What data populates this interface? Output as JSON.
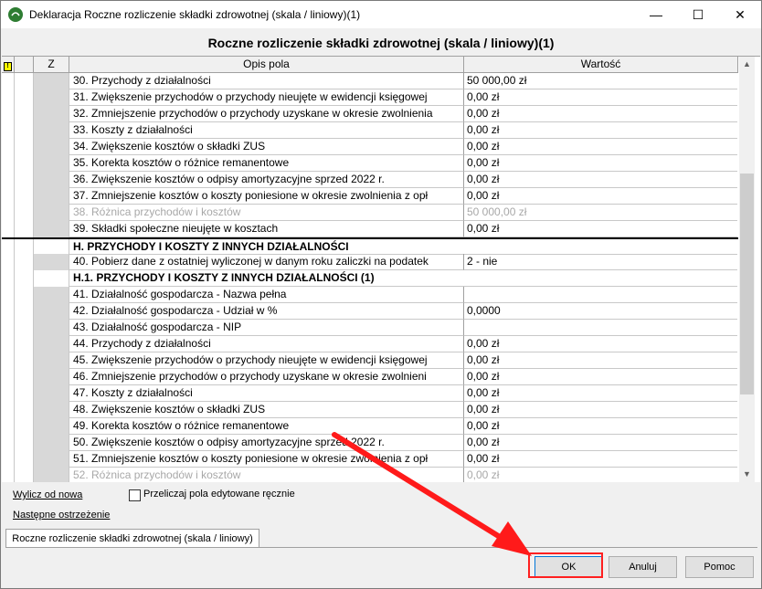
{
  "window": {
    "title": "Deklaracja Roczne rozliczenie składki zdrowotnej (skala / liniowy)(1)",
    "minimize_glyph": "—",
    "maximize_glyph": "☐",
    "close_glyph": "✕"
  },
  "form": {
    "heading": "Roczne rozliczenie składki zdrowotnej (skala / liniowy)(1)"
  },
  "grid": {
    "columns": {
      "flag": "!",
      "z": "Z",
      "desc": "Opis pola",
      "value": "Wartość"
    },
    "rows": [
      {
        "desc": "30. Przychody z działalności",
        "value": "50 000,00 zł",
        "kind": "normal"
      },
      {
        "desc": "31. Zwiększenie przychodów o przychody nieujęte w ewidencji księgowej",
        "value": "0,00 zł",
        "kind": "normal"
      },
      {
        "desc": "32. Zmniejszenie przychodów o przychody uzyskane w okresie zwolnienia",
        "value": "0,00 zł",
        "kind": "normal"
      },
      {
        "desc": "33. Koszty z działalności",
        "value": "0,00 zł",
        "kind": "normal"
      },
      {
        "desc": "34. Zwiększenie kosztów o składki ZUS",
        "value": "0,00 zł",
        "kind": "normal"
      },
      {
        "desc": "35. Korekta kosztów o różnice remanentowe",
        "value": "0,00 zł",
        "kind": "normal"
      },
      {
        "desc": "36. Zwiększenie kosztów o odpisy amortyzacyjne sprzed 2022 r.",
        "value": "0,00 zł",
        "kind": "normal"
      },
      {
        "desc": "37. Zmniejszenie kosztów o koszty poniesione w okresie zwolnienia z opł",
        "value": "0,00 zł",
        "kind": "normal"
      },
      {
        "desc": "38. Różnica przychodów i kosztów",
        "value": "50 000,00 zł",
        "kind": "disabled"
      },
      {
        "desc": "39. Składki społeczne nieujęte w kosztach",
        "value": "0,00 zł",
        "kind": "normal"
      },
      {
        "desc": "H. PRZYCHODY I KOSZTY Z INNYCH DZIAŁALNOŚCI",
        "value": "",
        "kind": "hsection"
      },
      {
        "desc": "40. Pobierz dane z ostatniej wyliczonej w danym roku zaliczki na podatek",
        "value": "2 - nie",
        "kind": "normal"
      },
      {
        "desc": "H.1. PRZYCHODY I KOSZTY Z INNYCH DZIAŁALNOŚCI (1)",
        "value": "",
        "kind": "section"
      },
      {
        "desc": "41. Działalność gospodarcza - Nazwa pełna",
        "value": "",
        "kind": "normal"
      },
      {
        "desc": "42. Działalność gospodarcza - Udział w %",
        "value": "0,0000",
        "kind": "normal"
      },
      {
        "desc": "43. Działalność gospodarcza - NIP",
        "value": "",
        "kind": "normal"
      },
      {
        "desc": "44. Przychody z działalności",
        "value": "0,00 zł",
        "kind": "normal"
      },
      {
        "desc": "45. Zwiększenie przychodów o przychody nieujęte w ewidencji księgowej",
        "value": "0,00 zł",
        "kind": "normal"
      },
      {
        "desc": "46. Zmniejszenie przychodów o przychody uzyskane w okresie zwolnieni",
        "value": "0,00 zł",
        "kind": "normal"
      },
      {
        "desc": "47. Koszty z działalności",
        "value": "0,00 zł",
        "kind": "normal"
      },
      {
        "desc": "48. Zwiększenie kosztów o składki ZUS",
        "value": "0,00 zł",
        "kind": "normal"
      },
      {
        "desc": "49. Korekta kosztów o różnice remanentowe",
        "value": "0,00 zł",
        "kind": "normal"
      },
      {
        "desc": "50. Zwiększenie kosztów o odpisy amortyzacyjne sprzed 2022 r.",
        "value": "0,00 zł",
        "kind": "normal"
      },
      {
        "desc": "51. Zmniejszenie kosztów o koszty poniesione w okresie zwolnienia z opł",
        "value": "0,00 zł",
        "kind": "normal"
      },
      {
        "desc": "52. Różnica przychodów i kosztów",
        "value": "0,00 zł",
        "kind": "disabled"
      }
    ]
  },
  "footer": {
    "recalc_link": "Wylicz od nowa",
    "next_warning_link": "Następne ostrzeżenie",
    "recalc_checkbox_label": "Przeliczaj pola edytowane ręcznie",
    "tab_label": "Roczne rozliczenie składki zdrowotnej (skala / liniowy)"
  },
  "buttons": {
    "ok": "OK",
    "cancel": "Anuluj",
    "help": "Pomoc"
  },
  "colors": {
    "highlight": "#ff2020",
    "arrow": "#ff1a1a",
    "app_icon": "#2e7d32"
  }
}
